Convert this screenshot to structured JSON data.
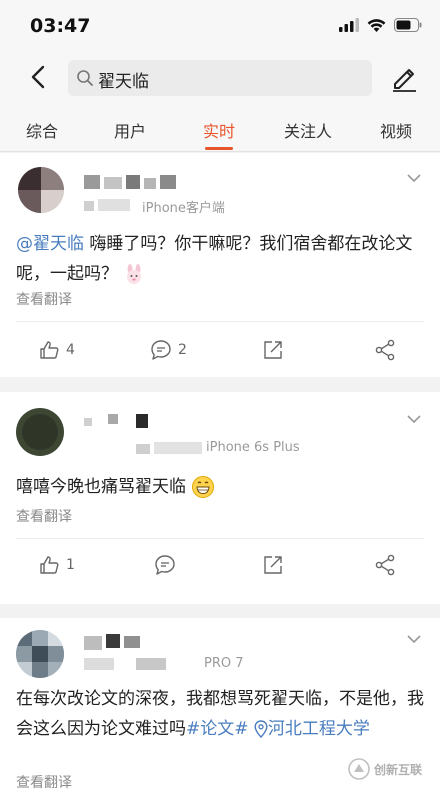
{
  "status": {
    "time": "03:47"
  },
  "search": {
    "query": "翟天临"
  },
  "tabs": [
    {
      "label": "综合"
    },
    {
      "label": "用户"
    },
    {
      "label": "实时"
    },
    {
      "label": "关注人"
    },
    {
      "label": "视频"
    }
  ],
  "posts": [
    {
      "source": "iPhone客户端",
      "mention": "@翟天临",
      "text_after_mention": " 嗨睡了吗？你干嘛呢？我们宿舍都在改论文呢，一起吗？",
      "translate": "查看翻译",
      "likes": "4",
      "comments": "2"
    },
    {
      "source": "iPhone 6s Plus",
      "text": "嘻嘻今晚也痛骂翟天临",
      "translate": "查看翻译",
      "likes": "1"
    },
    {
      "source": "PRO 7",
      "text": "在每次改论文的深夜，我都想骂死翟天临，不是他，我会这么因为论文难过吗",
      "hashtag": "#论文#",
      "location": "河北工程大学",
      "translate": "查看翻译"
    }
  ],
  "watermark": {
    "text": "创新互联"
  },
  "colors": {
    "accent": "#e8552d",
    "link": "#4a7dbf"
  }
}
